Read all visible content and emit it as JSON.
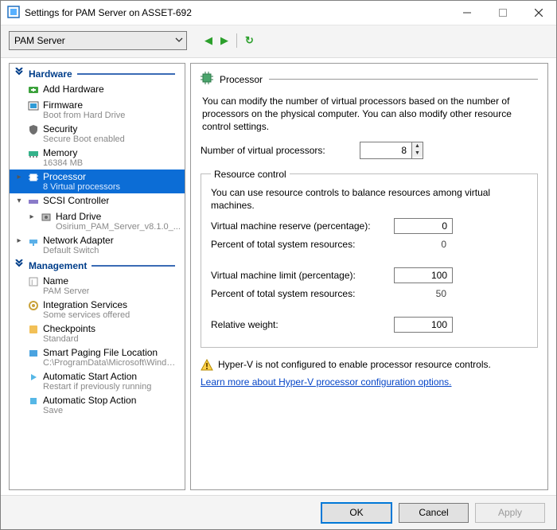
{
  "window": {
    "title": "Settings for PAM Server on ASSET-692"
  },
  "toolbar": {
    "vm_selected": "PAM Server"
  },
  "sidebar": {
    "hardware_section": "Hardware",
    "management_section": "Management",
    "items": [
      {
        "label": "Add Hardware",
        "sub": ""
      },
      {
        "label": "Firmware",
        "sub": "Boot from Hard Drive"
      },
      {
        "label": "Security",
        "sub": "Secure Boot enabled"
      },
      {
        "label": "Memory",
        "sub": "16384 MB"
      },
      {
        "label": "Processor",
        "sub": "8 Virtual processors"
      },
      {
        "label": "SCSI Controller",
        "sub": ""
      },
      {
        "label": "Hard Drive",
        "sub": "Osirium_PAM_Server_v8.1.0_..."
      },
      {
        "label": "Network Adapter",
        "sub": "Default Switch"
      },
      {
        "label": "Name",
        "sub": "PAM Server"
      },
      {
        "label": "Integration Services",
        "sub": "Some services offered"
      },
      {
        "label": "Checkpoints",
        "sub": "Standard"
      },
      {
        "label": "Smart Paging File Location",
        "sub": "C:\\ProgramData\\Microsoft\\Windo..."
      },
      {
        "label": "Automatic Start Action",
        "sub": "Restart if previously running"
      },
      {
        "label": "Automatic Stop Action",
        "sub": "Save"
      }
    ]
  },
  "panel": {
    "title": "Processor",
    "description": "You can modify the number of virtual processors based on the number of processors on the physical computer. You can also modify other resource control settings.",
    "num_vproc_label": "Number of virtual processors:",
    "num_vproc_value": "8",
    "resource_group_title": "Resource control",
    "resource_group_desc": "You can use resource controls to balance resources among virtual machines.",
    "rows": {
      "reserve_label": "Virtual machine reserve (percentage):",
      "reserve_value": "0",
      "reserve_pct_label": "Percent of total system resources:",
      "reserve_pct_value": "0",
      "limit_label": "Virtual machine limit (percentage):",
      "limit_value": "100",
      "limit_pct_label": "Percent of total system resources:",
      "limit_pct_value": "50",
      "weight_label": "Relative weight:",
      "weight_value": "100"
    },
    "warning": "Hyper-V is not configured to enable processor resource controls.",
    "link": "Learn more about Hyper-V processor configuration options."
  },
  "footer": {
    "ok": "OK",
    "cancel": "Cancel",
    "apply": "Apply"
  }
}
